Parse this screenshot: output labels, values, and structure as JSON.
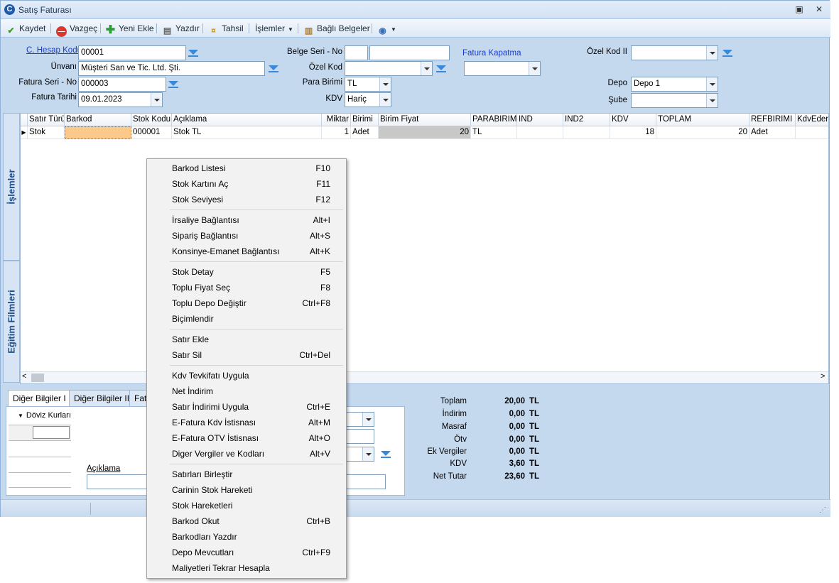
{
  "window": {
    "title": "Satış Faturası"
  },
  "toolbar": {
    "save": "Kaydet",
    "cancel": "Vazgeç",
    "new": "Yeni Ekle",
    "print": "Yazdır",
    "collect": "Tahsil",
    "actions": "İşlemler",
    "linked_docs": "Bağlı Belgeler"
  },
  "form": {
    "account_code_label": "C. Hesap Kodu",
    "account_code": "00001",
    "title_label": "Ünvanı",
    "title_value": "Müşteri San ve Tic. Ltd. Şti.",
    "invoice_series_label": "Fatura Seri - No",
    "invoice_series": "000003",
    "invoice_date_label": "Fatura Tarihi",
    "invoice_date": "09.01.2023",
    "doc_series_label": "Belge Seri - No",
    "special_code_label": "Özel Kod",
    "currency_label": "Para Birimi",
    "currency": "TL",
    "vat_label": "KDV",
    "vat": "Hariç",
    "invoice_close_label": "Fatura Kapatma",
    "special_code2_label": "Özel Kod II",
    "warehouse_label": "Depo",
    "warehouse": "Depo 1",
    "branch_label": "Şube"
  },
  "side_tabs": {
    "operations": "İşlemler",
    "training": "Eğitim Filmleri"
  },
  "grid": {
    "columns": [
      "Satır Türü",
      "Barkod",
      "Stok Kodu",
      "Açıklama",
      "Miktar",
      "Birimi",
      "Birim Fiyat",
      "PARABIRIMI",
      "IND",
      "IND2",
      "KDV",
      "TOPLAM",
      "REFBIRIMI",
      "KdvEderiT"
    ],
    "row": {
      "type": "Stok",
      "barcode": "",
      "stock_code": "000001",
      "description": "Stok TL",
      "quantity": "1",
      "unit": "Adet",
      "unit_price": "20",
      "currency": "TL",
      "ind": "",
      "ind2": "",
      "kdv": "18",
      "total": "20",
      "ref_unit": "Adet",
      "kdv_t": ""
    }
  },
  "bottom": {
    "tabs": [
      "Diğer Bilgiler I",
      "Diğer Bilgiler II",
      "Fatu"
    ],
    "currency_rates": "Döviz Kurları",
    "description_label": "Açıklama"
  },
  "totals": [
    {
      "label": "Toplam",
      "value": "20,00",
      "unit": "TL"
    },
    {
      "label": "İndirim",
      "value": "0,00",
      "unit": "TL"
    },
    {
      "label": "Masraf",
      "value": "0,00",
      "unit": "TL"
    },
    {
      "label": "Ötv",
      "value": "0,00",
      "unit": "TL"
    },
    {
      "label": "Ek Vergiler",
      "value": "0,00",
      "unit": "TL"
    },
    {
      "label": "KDV",
      "value": "3,60",
      "unit": "TL"
    },
    {
      "label": "Net Tutar",
      "value": "23,60",
      "unit": "TL"
    }
  ],
  "context_menu": {
    "items": [
      {
        "label": "Barkod Listesi",
        "shortcut": "F10"
      },
      {
        "label": "Stok Kartını Aç",
        "shortcut": "F11"
      },
      {
        "label": "Stok Seviyesi",
        "shortcut": "F12"
      },
      {
        "label": "İrsaliye Bağlantısı",
        "shortcut": "Alt+I"
      },
      {
        "label": "Sipariş Bağlantısı",
        "shortcut": "Alt+S"
      },
      {
        "label": "Konsinye-Emanet Bağlantısı",
        "shortcut": "Alt+K"
      },
      {
        "label": "Stok Detay",
        "shortcut": "F5"
      },
      {
        "label": "Toplu Fiyat Seç",
        "shortcut": "F8"
      },
      {
        "label": "Toplu Depo Değiştir",
        "shortcut": "Ctrl+F8"
      },
      {
        "label": "Biçimlendir",
        "shortcut": ""
      },
      {
        "label": "Satır Ekle",
        "shortcut": ""
      },
      {
        "label": "Satır Sil",
        "shortcut": "Ctrl+Del"
      },
      {
        "label": "Kdv Tevkifatı Uygula",
        "shortcut": ""
      },
      {
        "label": "Net İndirim",
        "shortcut": ""
      },
      {
        "label": "Satır İndirimi Uygula",
        "shortcut": "Ctrl+E"
      },
      {
        "label": "E-Fatura Kdv İstisnası",
        "shortcut": "Alt+M"
      },
      {
        "label": "E-Fatura OTV İstisnası",
        "shortcut": "Alt+O"
      },
      {
        "label": "Diger Vergiler ve Kodları",
        "shortcut": "Alt+V"
      },
      {
        "label": "Satırları Birleştir",
        "shortcut": ""
      },
      {
        "label": "Carinin Stok Hareketi",
        "shortcut": ""
      },
      {
        "label": "Stok Hareketleri",
        "shortcut": ""
      },
      {
        "label": "Barkod Okut",
        "shortcut": "Ctrl+B"
      },
      {
        "label": "Barkodları Yazdır",
        "shortcut": ""
      },
      {
        "label": "Depo Mevcutları",
        "shortcut": "Ctrl+F9"
      },
      {
        "label": "Maliyetleri Tekrar Hesapla",
        "shortcut": ""
      }
    ]
  }
}
